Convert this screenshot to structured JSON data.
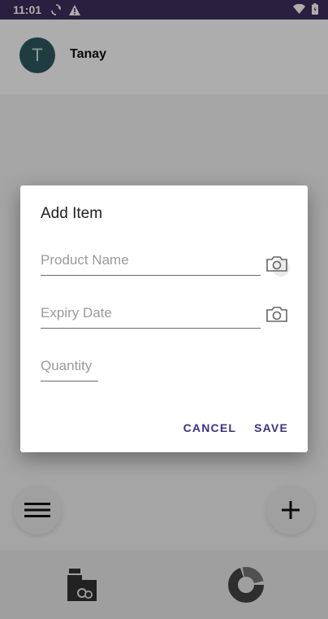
{
  "status_bar": {
    "time": "11:01",
    "icons": [
      "sync-icon",
      "warning-icon",
      "wifi-icon",
      "battery-icon"
    ]
  },
  "header": {
    "avatar_initial": "T",
    "user_name": "Tanay"
  },
  "dialog": {
    "title": "Add Item",
    "fields": {
      "product_name": {
        "placeholder": "Product Name",
        "value": ""
      },
      "expiry_date": {
        "placeholder": "Expiry Date",
        "value": ""
      },
      "quantity": {
        "placeholder": "Quantity",
        "value": ""
      }
    },
    "actions": {
      "cancel_label": "CANCEL",
      "save_label": "SAVE"
    }
  },
  "colors": {
    "status_bar": "#3d2f5c",
    "accent": "#3d2f8e",
    "avatar": "#2f5a5f"
  }
}
